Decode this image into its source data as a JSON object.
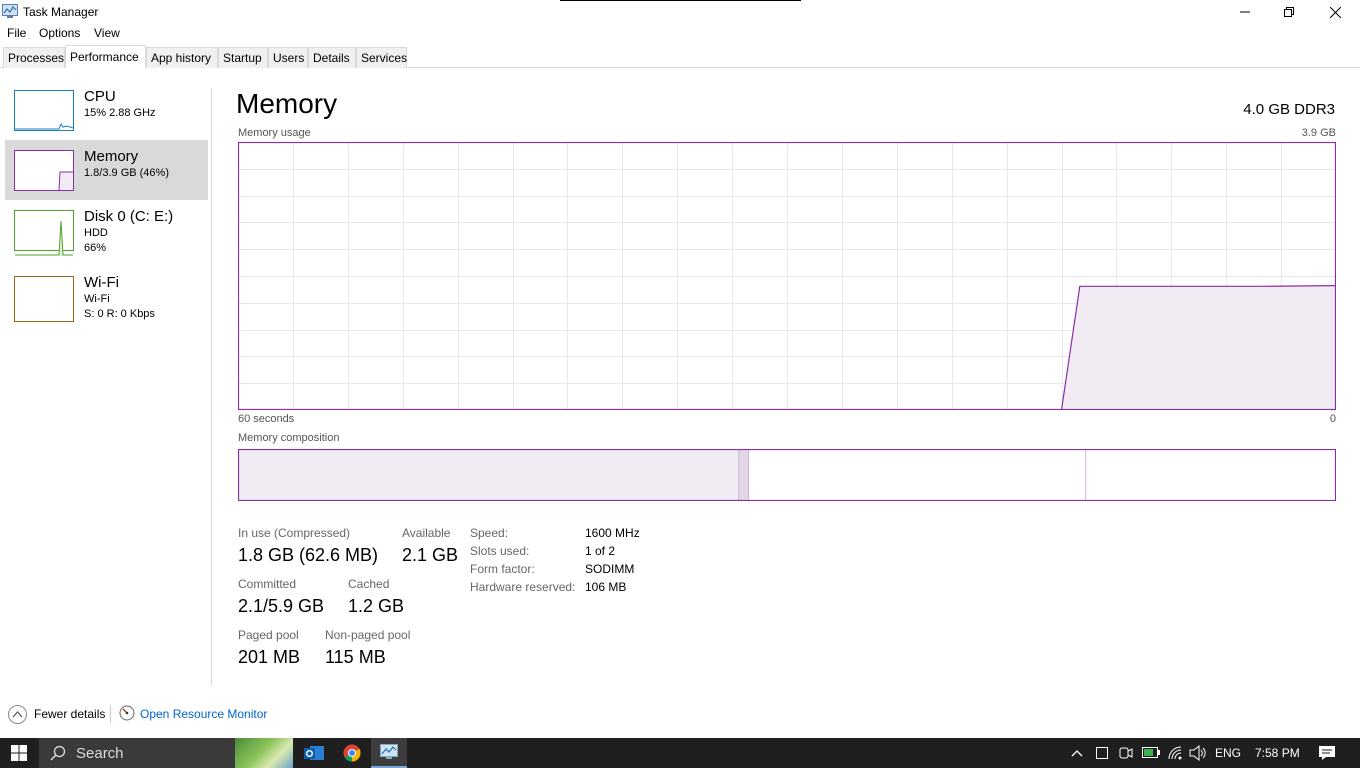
{
  "window": {
    "title": "Task Manager"
  },
  "menu": [
    "File",
    "Options",
    "View"
  ],
  "tabs": [
    "Processes",
    "Performance",
    "App history",
    "Startup",
    "Users",
    "Details",
    "Services"
  ],
  "active_tab": "Performance",
  "sidebar": {
    "items": [
      {
        "title": "CPU",
        "line1": "15% 2.88 GHz",
        "line2": "",
        "color": "#1a7fc0"
      },
      {
        "title": "Memory",
        "line1": "1.8/3.9 GB (46%)",
        "line2": "",
        "color": "#8b2da3",
        "selected": true
      },
      {
        "title": "Disk 0 (C: E:)",
        "line1": "HDD",
        "line2": "66%",
        "color": "#4da22a"
      },
      {
        "title": "Wi-Fi",
        "line1": "Wi-Fi",
        "line2": "S: 0 R: 0 Kbps",
        "color": "#a1661c"
      }
    ]
  },
  "main": {
    "title": "Memory",
    "spec": "4.0 GB DDR3",
    "usage_label": "Memory usage",
    "usage_max": "3.9 GB",
    "time_left": "60 seconds",
    "time_right": "0",
    "composition_label": "Memory composition"
  },
  "chart_data": {
    "type": "area",
    "title": "Memory usage",
    "xlabel": "",
    "ylabel": "",
    "x_range_label": [
      "60 seconds",
      "0"
    ],
    "ylim": [
      0,
      3.9
    ],
    "ymax_label": "3.9 GB",
    "x": [
      60,
      45,
      15,
      14,
      12,
      8,
      4,
      0
    ],
    "values": [
      0,
      0,
      0,
      1.8,
      1.8,
      1.8,
      1.8,
      1.81
    ],
    "color": "#8b2da3",
    "grid": true
  },
  "composition": {
    "in_use_fraction": 0.456,
    "modified_fraction": 0.009,
    "standby_fraction": 0.307,
    "free_fraction": 0.228
  },
  "stats": {
    "in_use_label": "In use (Compressed)",
    "in_use_value": "1.8 GB (62.6 MB)",
    "available_label": "Available",
    "available_value": "2.1 GB",
    "committed_label": "Committed",
    "committed_value": "2.1/5.9 GB",
    "cached_label": "Cached",
    "cached_value": "1.2 GB",
    "paged_label": "Paged pool",
    "paged_value": "201 MB",
    "nonpaged_label": "Non-paged pool",
    "nonpaged_value": "115 MB"
  },
  "properties": [
    {
      "label": "Speed:",
      "value": "1600 MHz"
    },
    {
      "label": "Slots used:",
      "value": "1 of 2"
    },
    {
      "label": "Form factor:",
      "value": "SODIMM"
    },
    {
      "label": "Hardware reserved:",
      "value": "106 MB"
    }
  ],
  "footer": {
    "fewer_details": "Fewer details",
    "resource_monitor": "Open Resource Monitor"
  },
  "taskbar": {
    "search_label": "Search",
    "language": "ENG",
    "time": "7:58 PM"
  }
}
